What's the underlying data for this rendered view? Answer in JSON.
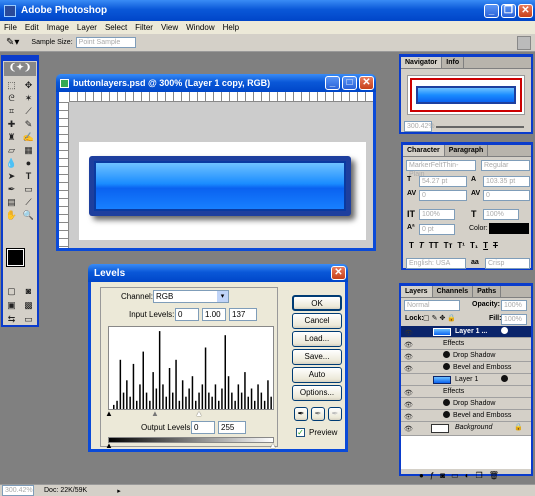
{
  "app": {
    "title": "Adobe Photoshop"
  },
  "menu": [
    "File",
    "Edit",
    "Image",
    "Layer",
    "Select",
    "Filter",
    "View",
    "Window",
    "Help"
  ],
  "options": {
    "sample_label": "Sample Size:",
    "sample_value": "Point Sample"
  },
  "doc": {
    "title": "buttonlayers.psd @ 300% (Layer 1 copy, RGB)"
  },
  "navigator": {
    "tabs": [
      "Navigator",
      "Info"
    ],
    "zoom": "300.42%"
  },
  "character": {
    "tabs": [
      "Character",
      "Paragraph"
    ],
    "font": "MarkerFeltThin-Plain",
    "style": "Regular",
    "size": "54.27 pt",
    "leading": "103.35 pt",
    "kern": "0",
    "track": "0",
    "vscale": "100%",
    "hscale": "100%",
    "baseline": "0 pt",
    "color_label": "Color:",
    "language": "English: USA",
    "aa_label": "aa",
    "aa": "Crisp"
  },
  "layers": {
    "tabs": [
      "Layers",
      "Channels",
      "Paths"
    ],
    "blend": "Normal",
    "opacity_label": "Opacity:",
    "opacity": "100%",
    "lock_label": "Lock:",
    "fill_label": "Fill:",
    "fill": "100%",
    "rows": [
      {
        "name": "Layer 1 ..."
      },
      {
        "name": "Effects"
      },
      {
        "name": "Drop Shadow"
      },
      {
        "name": "Bevel and Emboss"
      },
      {
        "name": "Layer 1"
      },
      {
        "name": "Effects"
      },
      {
        "name": "Drop Shadow"
      },
      {
        "name": "Bevel and Emboss"
      },
      {
        "name": "Background"
      }
    ]
  },
  "levels": {
    "title": "Levels",
    "channel_label": "Channel:",
    "channel": "RGB",
    "input_label": "Input Levels:",
    "input": [
      "0",
      "1.00",
      "137"
    ],
    "output_label": "Output Levels:",
    "output": [
      "0",
      "255"
    ],
    "buttons": [
      "OK",
      "Cancel",
      "Load...",
      "Save...",
      "Auto",
      "Options..."
    ],
    "preview": "Preview",
    "histogram": [
      0.05,
      0.1,
      0.6,
      0.2,
      0.35,
      0.15,
      0.55,
      0.1,
      0.3,
      0.7,
      0.2,
      0.1,
      0.45,
      0.25,
      0.95,
      0.3,
      0.15,
      0.5,
      0.2,
      0.6,
      0.1,
      0.35,
      0.15,
      0.25,
      0.4,
      0.1,
      0.2,
      0.3,
      0.75,
      0.2,
      0.15,
      0.3,
      0.1,
      0.25,
      0.9,
      0.4,
      0.2,
      0.1,
      0.3,
      0.2,
      0.45,
      0.15,
      0.25,
      0.1,
      0.3,
      0.2,
      0.1,
      0.35,
      0.15,
      0.05
    ]
  },
  "status": {
    "zoom": "300.42%",
    "doc": "Doc: 22K/59K"
  }
}
